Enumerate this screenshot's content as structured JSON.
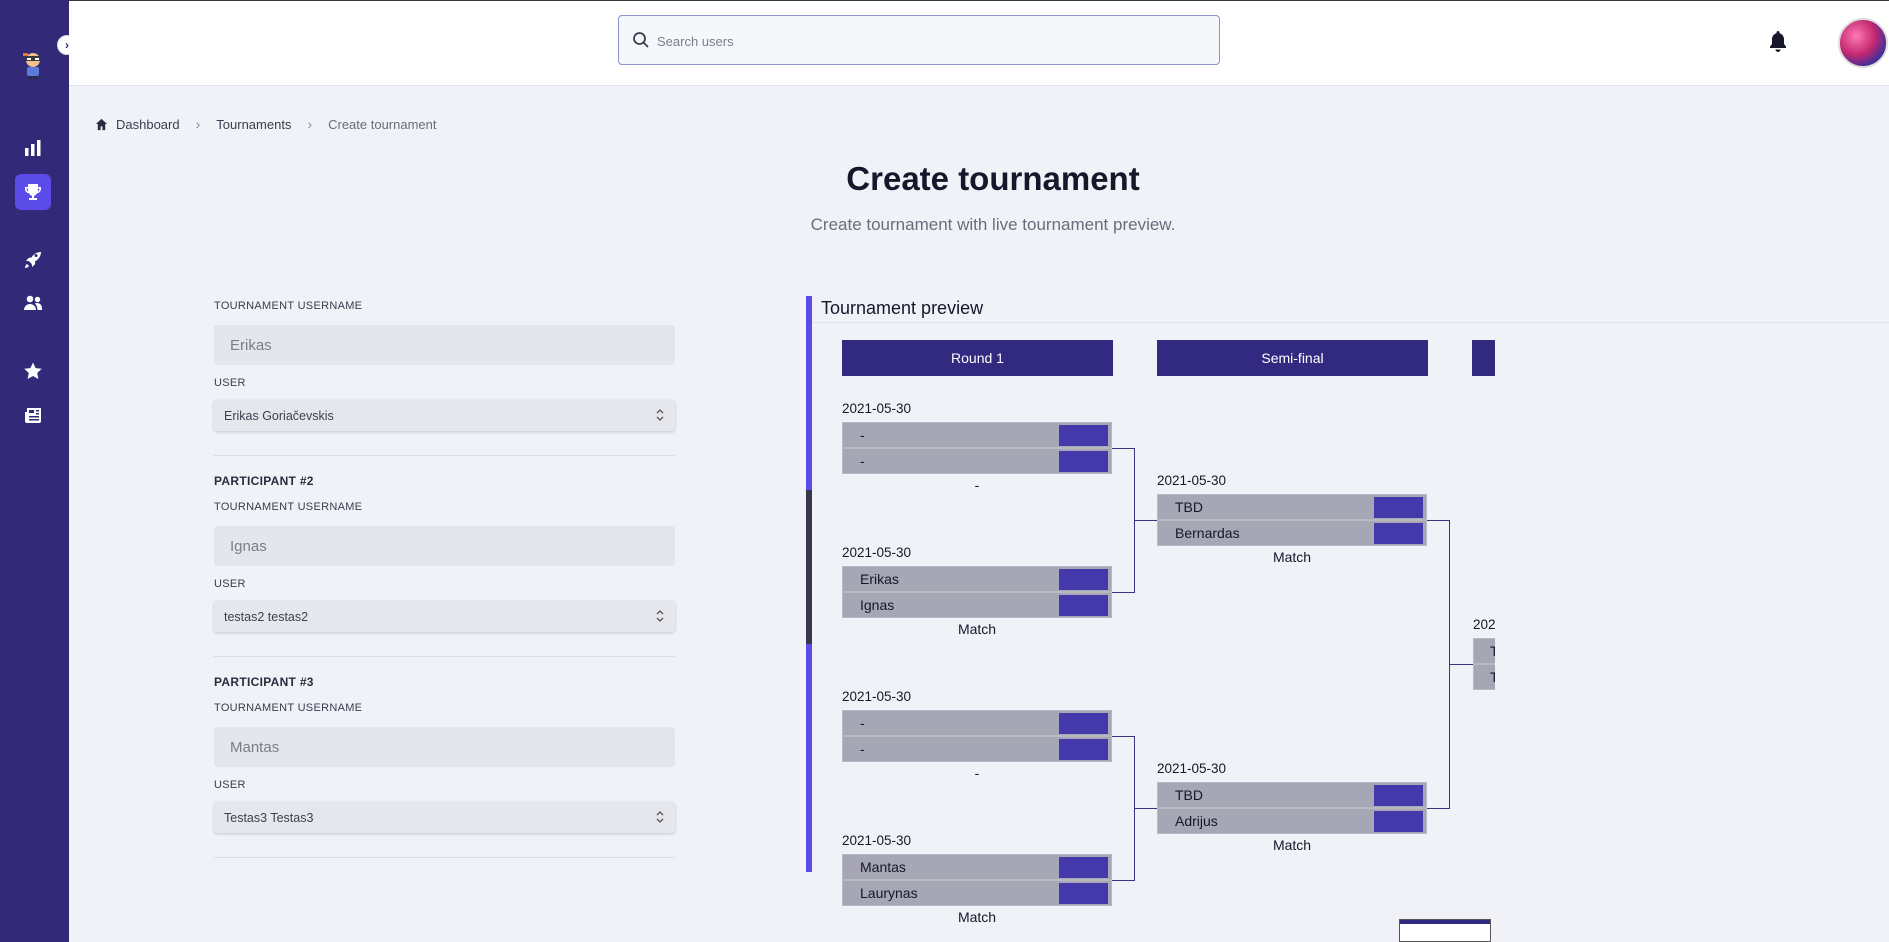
{
  "header": {
    "search_placeholder": "Search users"
  },
  "sidebar": {
    "items": [
      {
        "icon": "bar-chart-icon",
        "active": false
      },
      {
        "icon": "trophy-icon",
        "active": true
      },
      {
        "icon": "rocket-icon",
        "active": false
      },
      {
        "icon": "users-icon",
        "active": false
      },
      {
        "icon": "star-icon",
        "active": false
      },
      {
        "icon": "newspaper-icon",
        "active": false
      }
    ],
    "toggle": "›"
  },
  "breadcrumb": {
    "home": "Dashboard",
    "section": "Tournaments",
    "current": "Create tournament"
  },
  "page": {
    "title": "Create tournament",
    "subtitle": "Create tournament with live tournament preview."
  },
  "form": {
    "participant1": {
      "username_label": "TOURNAMENT USERNAME",
      "username_value": "Erikas",
      "user_label": "USER",
      "user_value": "Erikas Goriačevskis"
    },
    "participant2": {
      "title": "PARTICIPANT #2",
      "username_label": "TOURNAMENT USERNAME",
      "username_value": "Ignas",
      "user_label": "USER",
      "user_value": "testas2 testas2"
    },
    "participant3": {
      "title": "PARTICIPANT #3",
      "username_label": "TOURNAMENT USERNAME",
      "username_value": "Mantas",
      "user_label": "USER",
      "user_value": "Testas3 Testas3"
    }
  },
  "preview": {
    "title": "Tournament preview",
    "rounds": [
      "Round 1",
      "Semi-final"
    ],
    "round1": [
      {
        "date": "2021-05-30",
        "teams": [
          "-",
          "-"
        ],
        "label": "-"
      },
      {
        "date": "2021-05-30",
        "teams": [
          "Erikas",
          "Ignas"
        ],
        "label": "Match"
      },
      {
        "date": "2021-05-30",
        "teams": [
          "-",
          "-"
        ],
        "label": "-"
      },
      {
        "date": "2021-05-30",
        "teams": [
          "Mantas",
          "Laurynas"
        ],
        "label": "Match"
      }
    ],
    "semifinal": [
      {
        "date": "2021-05-30",
        "teams": [
          "TBD",
          "Bernardas"
        ],
        "label": "Match"
      },
      {
        "date": "2021-05-30",
        "teams": [
          "TBD",
          "Adrijus"
        ],
        "label": "Match"
      }
    ],
    "final_partial": {
      "date": "202",
      "team1": "T",
      "team2": "T"
    }
  },
  "colors": {
    "sidebar": "#322a78",
    "accent": "#5b4ce8",
    "round_header": "#322a80",
    "score_box": "#4339ab"
  }
}
